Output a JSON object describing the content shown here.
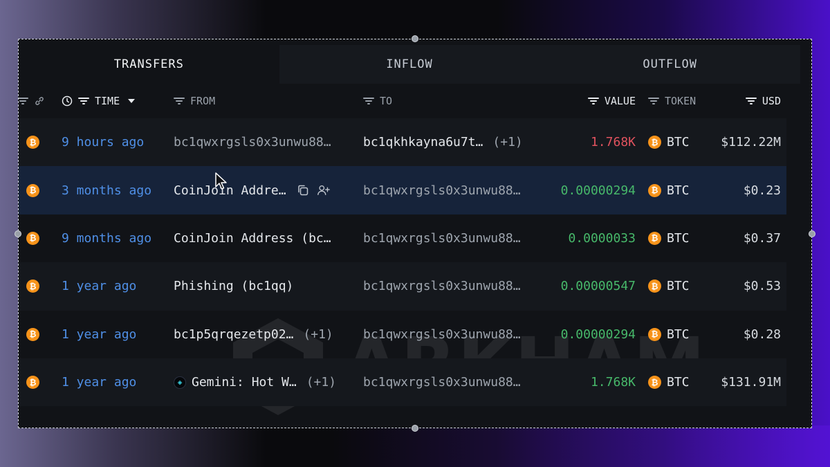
{
  "tabs": [
    {
      "label": "TRANSFERS",
      "active": true
    },
    {
      "label": "INFLOW",
      "active": false
    },
    {
      "label": "OUTFLOW",
      "active": false
    }
  ],
  "columns": {
    "time": "TIME",
    "from": "FROM",
    "to": "TO",
    "value": "VALUE",
    "token": "TOKEN",
    "usd": "USD"
  },
  "watermark": "ARKHAM",
  "rows": [
    {
      "time": "9 hours ago",
      "from": "bc1qwxrgsls0x3unwu88…",
      "from_extra": "",
      "to": "bc1qkhkayna6u7t…",
      "to_extra": "(+1)",
      "value": "1.768K",
      "value_color": "#e0525e",
      "token": "BTC",
      "usd": "$112.22M"
    },
    {
      "time": "3 months ago",
      "from": "CoinJoin Addre…",
      "from_extra": "",
      "to": "bc1qwxrgsls0x3unwu88…",
      "to_extra": "",
      "value": "0.00000294",
      "value_color": "#47b86a",
      "token": "BTC",
      "usd": "$0.23"
    },
    {
      "time": "9 months ago",
      "from": "CoinJoin Address (bc…",
      "from_extra": "",
      "to": "bc1qwxrgsls0x3unwu88…",
      "to_extra": "",
      "value": "0.0000033",
      "value_color": "#47b86a",
      "token": "BTC",
      "usd": "$0.37"
    },
    {
      "time": "1 year ago",
      "from": "Phishing (bc1qq)",
      "from_extra": "",
      "to": "bc1qwxrgsls0x3unwu88…",
      "to_extra": "",
      "value": "0.00000547",
      "value_color": "#47b86a",
      "token": "BTC",
      "usd": "$0.53"
    },
    {
      "time": "1 year ago",
      "from": "bc1p5qrqezetp02…",
      "from_extra": "(+1)",
      "to": "bc1qwxrgsls0x3unwu88…",
      "to_extra": "",
      "value": "0.00000294",
      "value_color": "#47b86a",
      "token": "BTC",
      "usd": "$0.28"
    },
    {
      "time": "1 year ago",
      "from": "Gemini: Hot W…",
      "from_extra": "(+1)",
      "to": "bc1qwxrgsls0x3unwu88…",
      "to_extra": "",
      "value": "1.768K",
      "value_color": "#47b86a",
      "token": "BTC",
      "usd": "$131.91M"
    }
  ],
  "icons": {
    "coin": "bitcoin-icon",
    "gemini": "gemini-icon",
    "copy": "copy-icon",
    "add_user": "add-user-icon",
    "clock": "clock-icon",
    "link": "link-icon",
    "filter": "filter-icon"
  },
  "colors": {
    "accent_blue": "#4f8fe6",
    "negative": "#e0525e",
    "positive": "#47b86a",
    "btc_orange": "#f7931a"
  }
}
